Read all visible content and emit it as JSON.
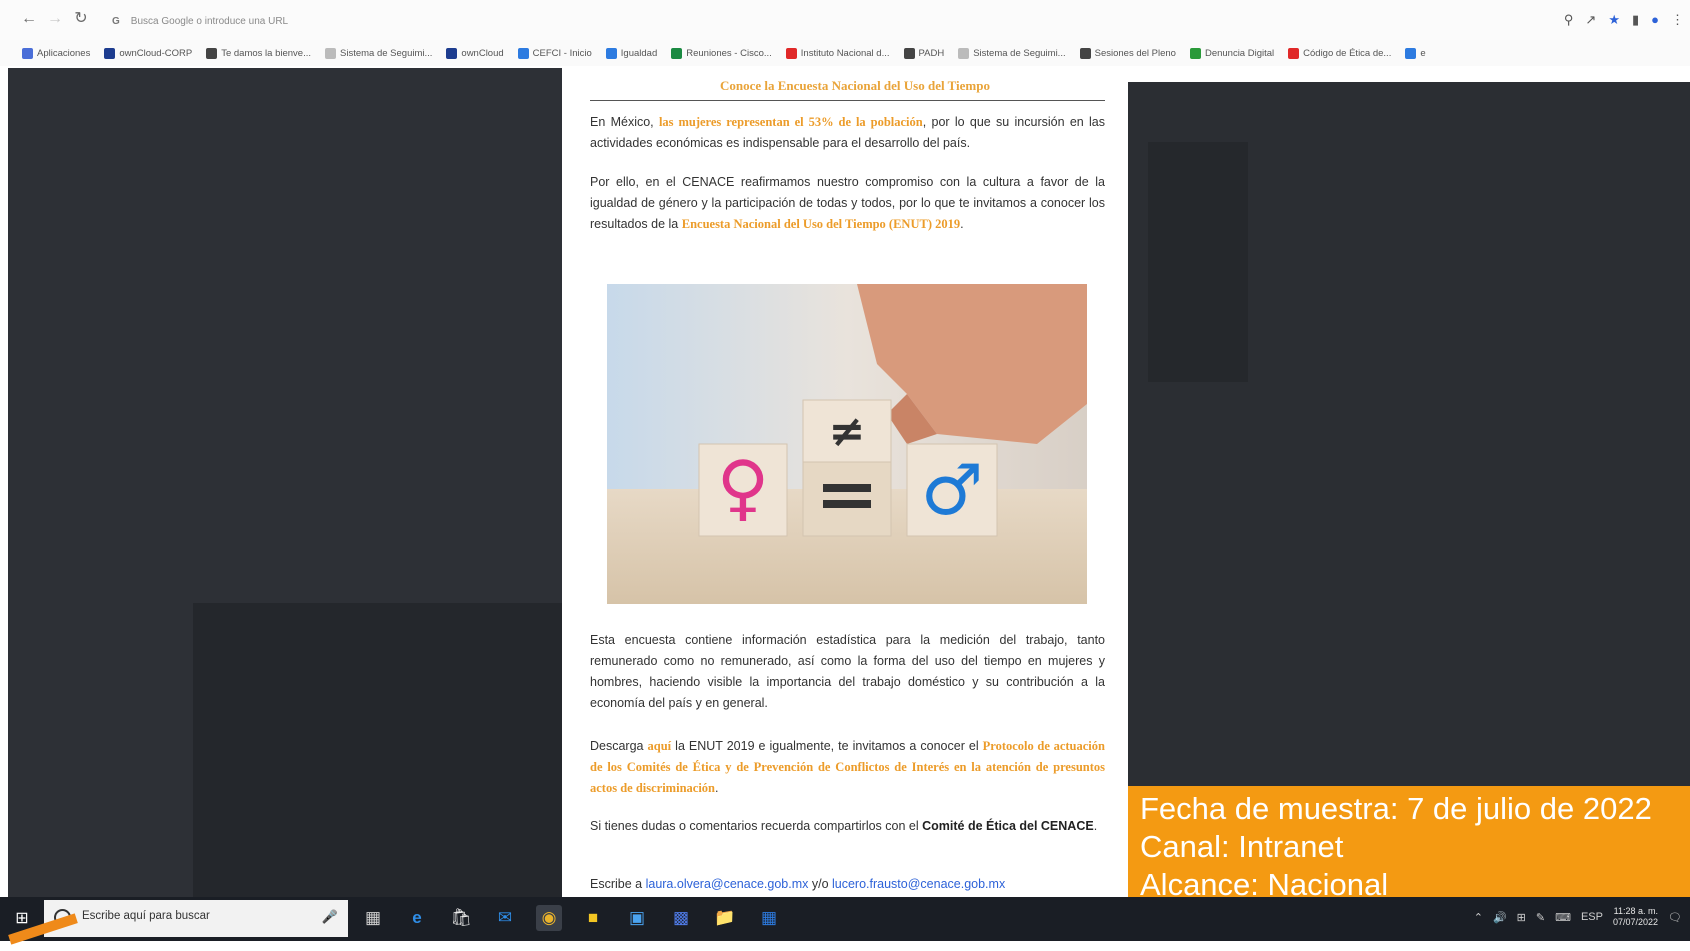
{
  "browser": {
    "address_placeholder": "Busca Google o introduce una URL",
    "bookmarks": [
      {
        "label": "Aplicaciones",
        "color": "#4a6ed8"
      },
      {
        "label": "ownCloud-CORP",
        "color": "#1d3c8f"
      },
      {
        "label": "Te damos la bienve...",
        "color": "#444444"
      },
      {
        "label": "Sistema de Seguimi...",
        "color": "#bbbbbb"
      },
      {
        "label": "ownCloud",
        "color": "#1d3c8f"
      },
      {
        "label": "CEFCI - Inicio",
        "color": "#2d7be0"
      },
      {
        "label": "Igualdad",
        "color": "#2d7be0"
      },
      {
        "label": "Reuniones - Cisco...",
        "color": "#1b8a42"
      },
      {
        "label": "Instituto Nacional d...",
        "color": "#e02828"
      },
      {
        "label": "PADH",
        "color": "#444444"
      },
      {
        "label": "Sistema de Seguimi...",
        "color": "#bbbbbb"
      },
      {
        "label": "Sesiones del Pleno",
        "color": "#444444"
      },
      {
        "label": "Denuncia Digital",
        "color": "#2a9a3a"
      },
      {
        "label": "Código de Ética de...",
        "color": "#e02828"
      },
      {
        "label": "e",
        "color": "#2d7be0"
      }
    ]
  },
  "article": {
    "title": "Conoce la Encuesta Nacional del Uso del Tiempo",
    "p1_pre": "En México, ",
    "p1_hl": "las mujeres representan el 53% de la población",
    "p1_post": ", por lo que su incursión en las actividades económicas es indispensable para el desarrollo del país.",
    "p2_pre": "Por ello, en el CENACE reafirmamos nuestro compromiso con la cultura a favor de la igualdad de género y la participación de todas y todos, por lo que te invitamos a conocer los resultados de la ",
    "p2_hl": "Encuesta Nacional del Uso del Tiempo (ENUT) 2019",
    "p2_post": ".",
    "p3": "Esta encuesta contiene información estadística para la medición del trabajo, tanto remunerado como no remunerado, así como la forma del uso del tiempo en mujeres y hombres, haciendo visible la importancia del trabajo doméstico y su contribución a la economía del país y en general.",
    "p4_pre": "Descarga ",
    "p4_link": "aquí",
    "p4_mid": " la ENUT 2019 e igualmente, te invitamos a conocer el ",
    "p4_hl": "Protocolo de actuación de los Comités de Ética y de Prevención de Conflictos de Interés en la atención de presuntos actos de discriminación",
    "p4_post": ".",
    "p5_pre": "Si tienes dudas o comentarios recuerda compartirlos con el ",
    "p5_bold": "Comité de Ética del CENACE",
    "p5_post": ".",
    "p6_pre": "Escribe a ",
    "email1": "laura.olvera@cenace.gob.mx",
    "p6_mid": " y/o ",
    "email2": "lucero.frausto@cenace.gob.mx"
  },
  "banner": {
    "line1": "Fecha de muestra: 7 de julio de 2022",
    "line2": "Canal: Intranet",
    "line3": "Alcance: Nacional"
  },
  "taskbar": {
    "search_placeholder": "Escribe aquí para buscar",
    "time": "11:28 a. m.",
    "date": "07/07/2022",
    "lang": "ESP"
  },
  "colors": {
    "accent_orange": "#f49a12",
    "highlight_text": "#ec9c2a",
    "link_blue": "#2d62d8",
    "taskbar": "#1a1e25"
  }
}
